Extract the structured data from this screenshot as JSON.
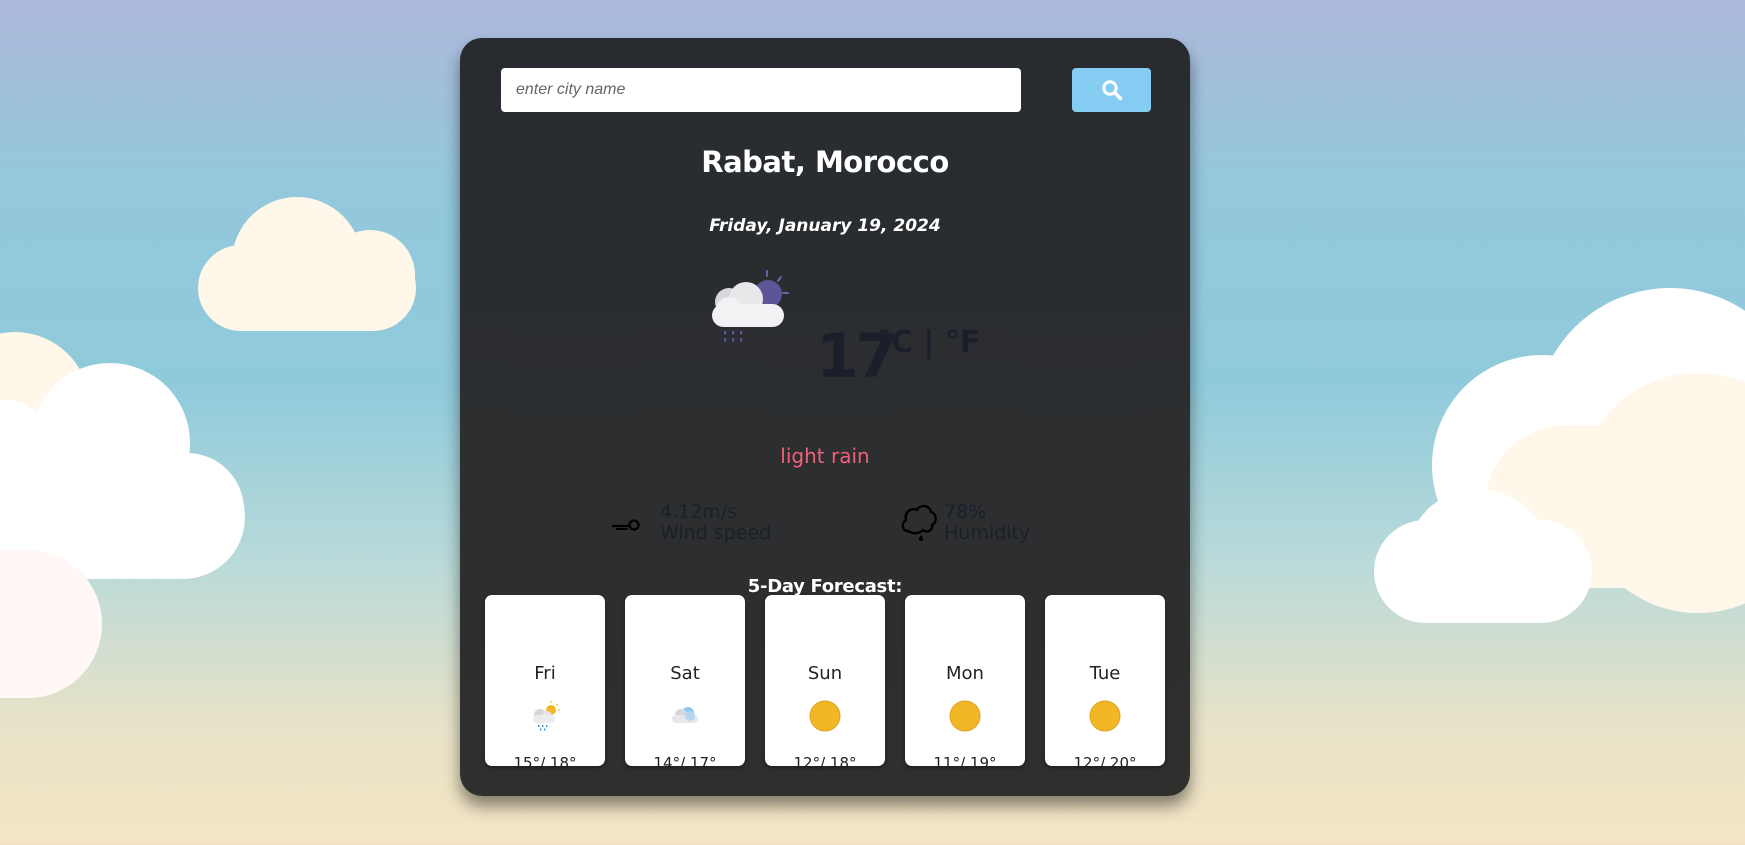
{
  "search": {
    "placeholder": "enter city name",
    "value": ""
  },
  "current": {
    "city": "Rabat, Morocco",
    "date": "Friday, January 19, 2024",
    "icon": "cloud-rain-night-icon",
    "temperature": "17",
    "units": "°C | °F",
    "condition": "light rain",
    "wind_value": "4.12m/s",
    "wind_label": "Wind speed",
    "humidity_value": "78%",
    "humidity_label": "Humidity"
  },
  "forecast": {
    "title": "5-Day Forecast:",
    "days": [
      {
        "day": "Fri",
        "icon": "rain-sun-icon",
        "low": "15°",
        "high": "18°"
      },
      {
        "day": "Sat",
        "icon": "cloud-icon",
        "low": "14°",
        "high": "17°"
      },
      {
        "day": "Sun",
        "icon": "sun-icon",
        "low": "12°",
        "high": "18°"
      },
      {
        "day": "Mon",
        "icon": "sun-icon",
        "low": "11°",
        "high": "19°"
      },
      {
        "day": "Tue",
        "icon": "sun-icon",
        "low": "12°",
        "high": "20°"
      }
    ]
  },
  "colors": {
    "accent": "#85ccf2",
    "condition": "#f06079",
    "card_bg": "#282c31",
    "sun": "#f2b726"
  }
}
